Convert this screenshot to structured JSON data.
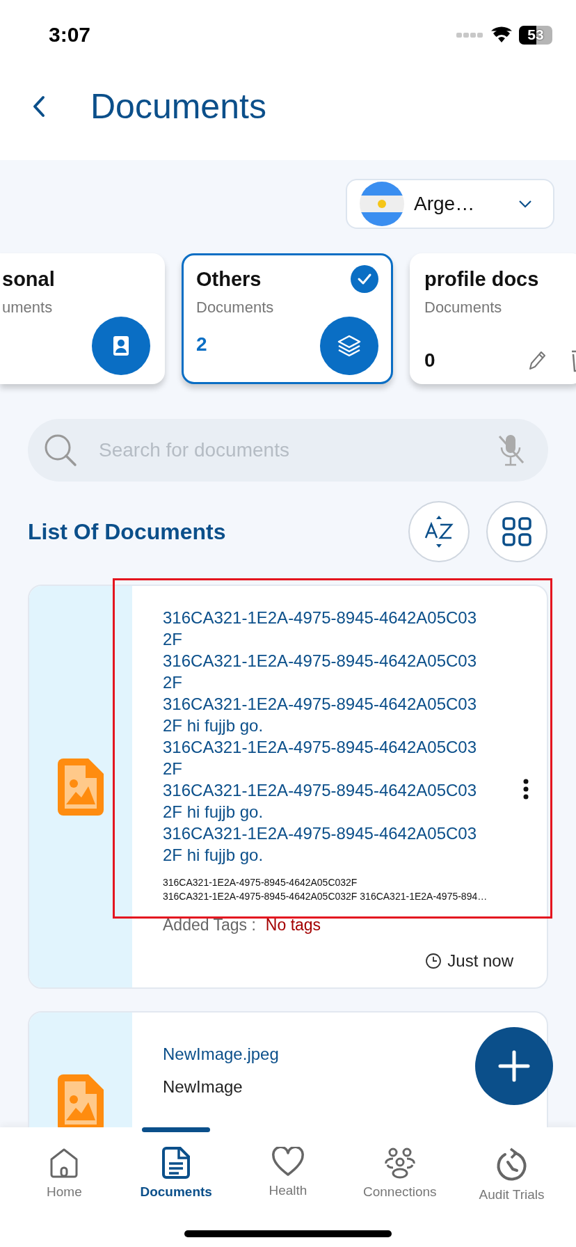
{
  "status_bar": {
    "time": "3:07",
    "battery": "53"
  },
  "header": {
    "title": "Documents"
  },
  "country_selector": {
    "label": "Arge…"
  },
  "categories": [
    {
      "title": "sonal",
      "subtitle": "uments",
      "selected": false
    },
    {
      "title": "Others",
      "subtitle": "Documents",
      "count": "2",
      "selected": true
    },
    {
      "title": "profile docs",
      "subtitle": "Documents",
      "count": "0",
      "selected": false
    }
  ],
  "search": {
    "placeholder": "Search for documents"
  },
  "list": {
    "title": "List Of Documents"
  },
  "documents": [
    {
      "title": "316CA321-1E2A-4975-8945-4642A05C03\n2F\n316CA321-1E2A-4975-8945-4642A05C03\n2F\n316CA321-1E2A-4975-8945-4642A05C03\n2F hi fujjb go.\n316CA321-1E2A-4975-8945-4642A05C03\n2F\n316CA321-1E2A-4975-8945-4642A05C03\n2F hi fujjb go.\n316CA321-1E2A-4975-8945-4642A05C03\n2F hi fujjb go.",
      "description": "316CA321-1E2A-4975-8945-4642A05C032F\n316CA321-1E2A-4975-8945-4642A05C032F 316CA321-1E2A-4975-894…",
      "tags_label": "Added Tags :",
      "tags_value": "No tags",
      "time": "Just now",
      "highlighted": true
    },
    {
      "title": "NewImage.jpeg",
      "description": "NewImage",
      "highlighted": false
    }
  ],
  "bottom_nav": [
    {
      "label": "Home",
      "selected": false
    },
    {
      "label": "Documents",
      "selected": true
    },
    {
      "label": "Health",
      "selected": false
    },
    {
      "label": "Connections",
      "selected": false
    },
    {
      "label": "Audit Trials",
      "selected": false
    }
  ]
}
